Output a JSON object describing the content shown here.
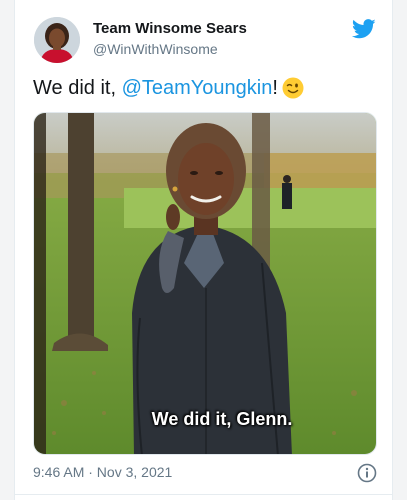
{
  "tweet": {
    "display_name": "Team Winsome Sears",
    "handle": "@WinWithWinsome",
    "text_prefix": "We did it, ",
    "mention": "@TeamYoungkin",
    "text_suffix": "!",
    "emoji": "winking-face",
    "timestamp": "9:46 AM · Nov 3, 2021"
  },
  "media": {
    "caption": "We did it, Glenn."
  },
  "icons": {
    "brand": "twitter-bird-icon",
    "info": "info-icon"
  },
  "colors": {
    "brand_blue": "#1da1f2",
    "mention_blue": "#1b95e0",
    "secondary_text": "#657786",
    "primary_text": "#14171a"
  }
}
